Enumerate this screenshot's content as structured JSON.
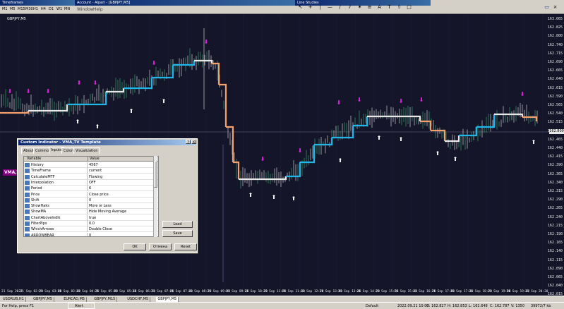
{
  "timeframes_panel": {
    "title": "Timeframes",
    "buttons": [
      "M1",
      "M5",
      "M15",
      "M30",
      "H1",
      "H4",
      "D1",
      "W1",
      "MN"
    ]
  },
  "main_window": {
    "title": "Account - Alpari - [GBPJPY,M5]",
    "menu": [
      "Window",
      "Help"
    ]
  },
  "line_studies_panel": {
    "title": "Line Studies",
    "tools": [
      "cursor-icon",
      "crosshair-icon",
      "vertical-line-icon",
      "horizontal-line-icon",
      "trendline-icon",
      "equidistant-channel-icon",
      "gann-fan-icon",
      "fibonacci-icon",
      "text-icon",
      "label-icon",
      "arrow-icon",
      "shape-icon"
    ]
  },
  "chart": {
    "symbol_label": "GBPJPY,M5",
    "indicator_tag": "VMA,TV",
    "current_price": "162.800",
    "price_levels": [
      "163.065",
      "162.825",
      "162.800",
      "162.740",
      "162.715",
      "162.690",
      "162.665",
      "162.640",
      "162.615",
      "162.590",
      "162.565",
      "162.540",
      "162.515",
      "162.490",
      "162.465",
      "162.440",
      "162.415",
      "162.390",
      "162.365",
      "162.340",
      "162.315",
      "162.290",
      "162.265",
      "162.240",
      "162.215",
      "162.190",
      "162.165",
      "162.140",
      "162.115",
      "162.090",
      "162.065",
      "162.040",
      "162.015"
    ],
    "time_labels": [
      "21 Sep 2022",
      "21 Sep 02:20",
      "21 Sep 03:00",
      "21 Sep 03:40",
      "21 Sep 04:20",
      "21 Sep 05:00",
      "21 Sep 05:40",
      "21 Sep 06:20",
      "21 Sep 07:00",
      "21 Sep 07:40",
      "21 Sep 08:20",
      "21 Sep 09:00",
      "21 Sep 09:40",
      "21 Sep 10:20",
      "21 Sep 11:00",
      "21 Sep 11:40",
      "21 Sep 12:20",
      "21 Sep 13:00",
      "21 Sep 13:40",
      "21 Sep 14:20",
      "21 Sep 15:00",
      "21 Sep 15:40",
      "21 Sep 16:20",
      "21 Sep 17:00",
      "21 Sep 17:40",
      "21 Sep 18:20",
      "21 Sep 19:00",
      "21 Sep 19:40",
      "21 Sep 20:20"
    ],
    "colors": {
      "bull": "#3cb371",
      "bear": "#e8e8e8",
      "vma_up": "#1fb6e8",
      "vma_down": "#f4a06c",
      "vma_flat": "#e8e8e8",
      "arrow_up": "#ffffff",
      "arrow_down": "#e020e0",
      "grid": "#1c1c38"
    }
  },
  "dialog": {
    "title": "Custom Indicator - VMA,TV Template",
    "help_button": "?",
    "close_button": "X",
    "tabs": [
      "About",
      "Common",
      "Inputs",
      "Colors",
      "Visualization"
    ],
    "active_tab": "Inputs",
    "columns": [
      "Variable",
      "Value"
    ],
    "rows": [
      {
        "name": "History",
        "value": "4567"
      },
      {
        "name": "TimeFrame",
        "value": "current"
      },
      {
        "name": "CalculateMTF",
        "value": "Flowing"
      },
      {
        "name": "Interpolation",
        "value": "OFF"
      },
      {
        "name": "Period",
        "value": "6"
      },
      {
        "name": "Price",
        "value": "Close price"
      },
      {
        "name": "Shift",
        "value": "0"
      },
      {
        "name": "ShowHaks",
        "value": "More or Less"
      },
      {
        "name": "ShowMA",
        "value": "Hide Moving Average"
      },
      {
        "name": "ChartAboveIndik",
        "value": "true"
      },
      {
        "name": "FilterPips",
        "value": "0.0"
      },
      {
        "name": "WhichArrows",
        "value": "Double Close"
      },
      {
        "name": "ARROWBEAR",
        "value": "0"
      }
    ],
    "buttons": {
      "load": "Load",
      "save": "Save",
      "ok": "OK",
      "cancel": "Отмена",
      "reset": "Reset"
    }
  },
  "chart_tabs": [
    "USDRUB,H1",
    "GBPJPY,M5",
    "EURCAD,M5",
    "GBPJPY,M15",
    "USDCHF,M5",
    "GBPJPY,M5"
  ],
  "active_chart_tab": "GBPJPY,M5",
  "status": {
    "help": "For Help, press F1",
    "alert": "Alert",
    "profile": "Default",
    "datetime": "2022.09.21 10:00",
    "open": "O: 162.827",
    "high": "H: 162.853",
    "low": "L: 162.648",
    "close": "C: 162.787",
    "volume": "V: 1350",
    "traffic": "39972/7 kb"
  }
}
